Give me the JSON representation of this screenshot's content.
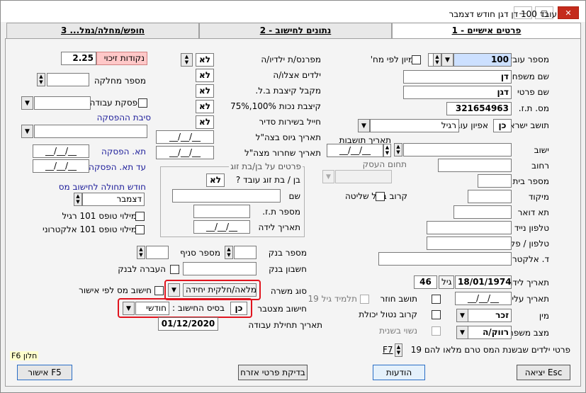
{
  "window": {
    "title": "עובד 100 דן דגן   חודש דצמבר",
    "minimize": "—",
    "maximize": "▢",
    "close": "✕"
  },
  "tabs": [
    {
      "label": "פרטים אישיים - 1",
      "active": true
    },
    {
      "label": "נתונים לחישוב - 2",
      "active": false
    },
    {
      "label": "חופש/מחלה/גמל... 3",
      "active": false
    }
  ],
  "right": {
    "employee_number_label": "מספר עובד",
    "employee_number": "100",
    "sort_label": "מיון לפי מח'",
    "last_name_label": "שם משפחה",
    "last_name": "דן",
    "first_name_label": "שם פרטי",
    "first_name": "דגן",
    "id_label": "מס. ת.ז.",
    "id": "321654963",
    "resident_label": "תושב ישראל",
    "resident": "כן",
    "employee_type_label": "אפיון עובד",
    "employee_type": "רגיל",
    "settlement_date_label": "תאריך תושבות",
    "settlement_date": "__/__/__",
    "yishuv_label": "ישוב",
    "street_label": "רחוב",
    "house_label": "מספר בית",
    "zip_label": "מיקוד",
    "pobox_label": "תא דואר",
    "mobile_label": "טלפון נייד",
    "phone_label": "טלפון / פקס",
    "email_label": "ד. אלקטרוני",
    "business_field_label": "תחום העסק",
    "controlling_label": "קרוב בעל שליטה",
    "birth_label": "תאריך לידה",
    "birth": "18/01/1974",
    "age_label": "גיל",
    "age": "46",
    "aliya_label": "תאריך עליה",
    "aliya": "__/__/__",
    "returning_label": "תושב חוזר",
    "student_label": "תלמיד גיל 19",
    "gender_label": "מין",
    "gender": "זכר",
    "disabled_label": "קרוב נטול יכולת",
    "marital_label": "מצב משפחתי",
    "marital": "רווק/ה",
    "second_spouse_label": "נשוי בשנית",
    "children_label": "פרטי ילדים שבשנת המס טרם מלאו להם 19",
    "children_key": "F7"
  },
  "middle": {
    "supports_children_label": "מפרנס/ת ילדיו/ה",
    "supports_children": "לא",
    "children_with_label": "ילדים אצלו/ה",
    "children_with": "לא",
    "allowance_label": "מקבל קיצבת ב.ל.",
    "allowance": "לא",
    "disability_label": "קיצבת נכות 100%,75%",
    "disability": "לא",
    "soldier_label": "חייל בשירות סדיר",
    "soldier": "לא",
    "army_start_label": "תאריך גיוס בצה\"ל",
    "army_start": "__/__/__",
    "army_end_label": "תאריך שחרור מצה\"ל",
    "army_end": "__/__/__",
    "spouse_group": "פרטים על בן/בת זוג",
    "spouse_employee_label": "בן / בת זוג עובד ?",
    "spouse_employee": "לא",
    "spouse_name_label": "שם",
    "spouse_id_label": "מספר ת.ז.",
    "spouse_birth_label": "תאריך לידה",
    "spouse_birth": "__/__/__",
    "bank_label": "מספר בנק",
    "branch_label": "מספר סניף",
    "account_label": "חשבון בנק",
    "bank_transfer_label": "העברה לבנק",
    "position_type_label": "סוג משרה",
    "position_type": "מלאה/חלקית יחידה",
    "cumulative_label": "חישוב מצטבר",
    "cumulative": "כן",
    "calc_basis_label": "בסיס החישוב :",
    "calc_basis": "חודשי",
    "start_date_label": "תאריך תחילת עבודה",
    "start_date": "01/12/2020"
  },
  "left": {
    "credit_points_label": "נקודות זיכוי",
    "credit_points": "2.25",
    "department_label": "מספר מחלקה",
    "stop_work_label": "הפסקת עבודה מ",
    "stop_reason_label": "סיבת ההפסקה",
    "to_stop_label": "תא. הפסקה",
    "to_stop": "__/__/__",
    "until_stop_label": "עד תא. הפסקה",
    "until_stop": "__/__/__",
    "start_month_label": "חודש תחולה לחישוב מס",
    "start_month": "דצמבר",
    "form101_label": "מילוי טופס 101 רגיל",
    "form101e_label": "מילוי טופס 101 אלקטרוני",
    "tax_approval_label": "חישוב מס לפי אישור",
    "f6_label": "F6 חלון"
  },
  "buttons": {
    "approve": "אישור F5",
    "check": "בדיקת פרטי אזרח",
    "messages": "הודעות",
    "exit": "יציאה Esc"
  }
}
